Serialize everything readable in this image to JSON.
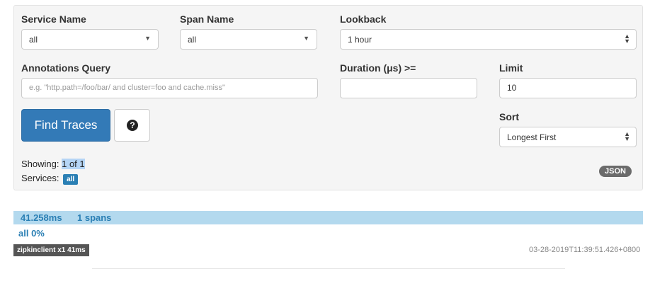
{
  "form": {
    "service_name": {
      "label": "Service Name",
      "value": "all"
    },
    "span_name": {
      "label": "Span Name",
      "value": "all"
    },
    "lookback": {
      "label": "Lookback",
      "value": "1 hour"
    },
    "annotations": {
      "label": "Annotations Query",
      "placeholder": "e.g. \"http.path=/foo/bar/ and cluster=foo and cache.miss\""
    },
    "duration": {
      "label": "Duration (μs) >=",
      "value": ""
    },
    "limit": {
      "label": "Limit",
      "value": "10"
    },
    "sort": {
      "label": "Sort",
      "value": "Longest First"
    },
    "find_button": "Find Traces",
    "help_icon_glyph": "?"
  },
  "results": {
    "showing_label": "Showing:",
    "showing_value": "1 of 1",
    "services_label": "Services:",
    "services_badge": "all",
    "json_button": "JSON"
  },
  "trace": {
    "duration": "41.258ms",
    "spans": "1 spans",
    "service_pct": "all 0%",
    "service_tag": "zipkinclient x1 41ms",
    "timestamp": "03-28-2019T11:39:51.426+0800"
  },
  "colors": {
    "primary": "#337ab7",
    "accent": "#2a7fb4",
    "trace_bar": "#b3d9ee"
  }
}
